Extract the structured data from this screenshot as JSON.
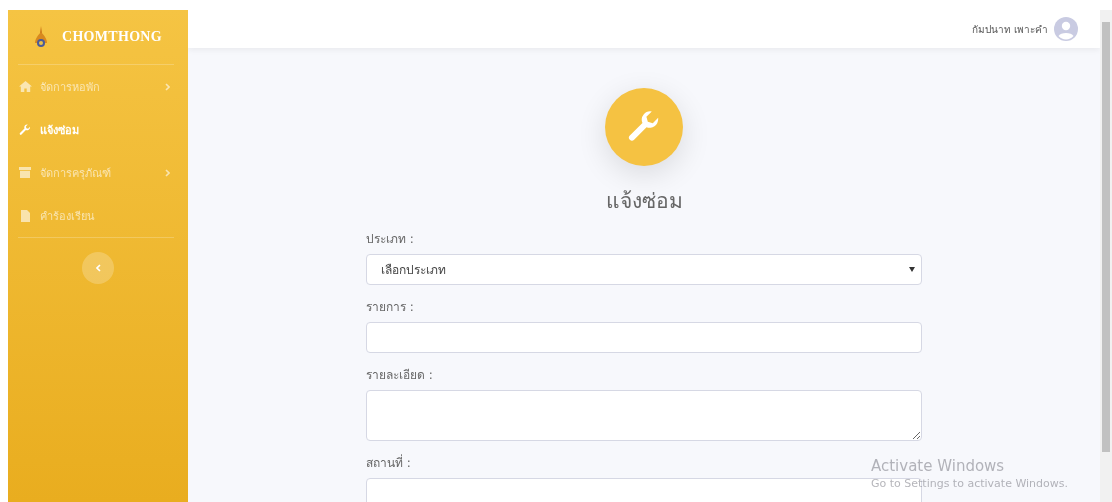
{
  "sidebar": {
    "brand": "CHOMTHONG",
    "items": [
      {
        "kind": "home",
        "label": "จัดการหอพัก",
        "has_submenu": true,
        "selected": false
      },
      {
        "kind": "wrench",
        "label": "แจ้งซ่อม",
        "has_submenu": false,
        "selected": true
      },
      {
        "kind": "box",
        "label": "จัดการครุภัณฑ์",
        "has_submenu": true,
        "selected": false
      },
      {
        "kind": "file",
        "label": "คำร้องเรียน",
        "has_submenu": false,
        "selected": false
      }
    ]
  },
  "topbar": {
    "user_name": "กัมปนาท เพาะคำ"
  },
  "form": {
    "title": "แจ้งซ่อม",
    "fields": [
      {
        "kind": "select",
        "label": "ประเภท :",
        "value": "เลือกประเภท"
      },
      {
        "kind": "input",
        "label": "รายการ :"
      },
      {
        "kind": "textarea",
        "label": "รายละเอียด :"
      },
      {
        "kind": "input",
        "label": "สถานที่ :"
      }
    ]
  },
  "os_notice": {
    "title": "Activate Windows",
    "message": "Go to Settings to activate Windows."
  }
}
